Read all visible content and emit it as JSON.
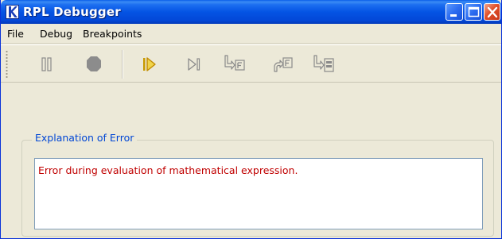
{
  "window": {
    "title": "RPL Debugger"
  },
  "menubar": {
    "items": [
      "File",
      "Debug",
      "Breakpoints"
    ]
  },
  "toolbar": {
    "buttons": [
      {
        "icon": "pause-icon",
        "enabled": false
      },
      {
        "icon": "stop-icon",
        "enabled": false
      },
      {
        "icon": "resume-icon",
        "enabled": true
      },
      {
        "icon": "step-icon",
        "enabled": false
      },
      {
        "icon": "step-into-function-icon",
        "enabled": false
      },
      {
        "icon": "step-out-function-icon",
        "enabled": false
      },
      {
        "icon": "step-over-statement-icon",
        "enabled": false
      }
    ]
  },
  "explanation": {
    "title": "Explanation of Error",
    "message": "Error during evaluation of mathematical expression."
  },
  "colors": {
    "titlebar": "#0454e4",
    "group_title": "#0046d5",
    "error_text": "#c00000",
    "resume_icon": "#c89a00"
  }
}
